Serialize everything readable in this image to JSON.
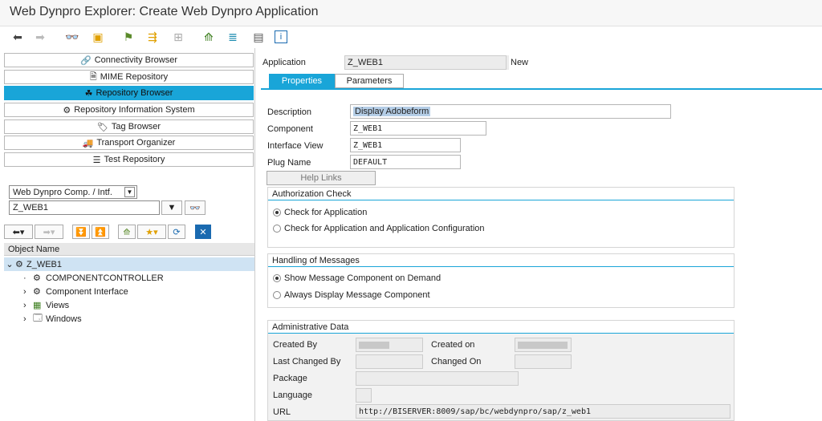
{
  "window": {
    "title": "Web Dynpro Explorer: Create Web Dynpro Application"
  },
  "nav": {
    "items": [
      {
        "label": "Connectivity Browser",
        "icon": "connectivity-icon"
      },
      {
        "label": "MIME Repository",
        "icon": "mime-icon"
      },
      {
        "label": "Repository Browser",
        "icon": "repository-icon",
        "active": true
      },
      {
        "label": "Repository Information System",
        "icon": "info-system-icon"
      },
      {
        "label": "Tag Browser",
        "icon": "tag-icon"
      },
      {
        "label": "Transport Organizer",
        "icon": "transport-icon"
      },
      {
        "label": "Test Repository",
        "icon": "test-icon"
      }
    ]
  },
  "object_selector": {
    "type_value": "Web Dynpro Comp. / Intf.",
    "name_value": "Z_WEB1"
  },
  "tree": {
    "header": "Object Name",
    "root": "Z_WEB1",
    "children": [
      "COMPONENTCONTROLLER",
      "Component Interface",
      "Views",
      "Windows"
    ]
  },
  "app": {
    "label": "Application",
    "value": "Z_WEB1",
    "status": "New"
  },
  "tabs": {
    "properties": "Properties",
    "parameters": "Parameters"
  },
  "props": {
    "description_label": "Description",
    "description_value": "Display Adobeform",
    "component_label": "Component",
    "component_value": "Z_WEB1",
    "interface_label": "Interface View",
    "interface_value": "Z_WEB1",
    "plug_label": "Plug Name",
    "plug_value": "DEFAULT",
    "help_links": "Help Links"
  },
  "auth": {
    "title": "Authorization Check",
    "opt1": "Check for Application",
    "opt2": "Check for Application and Application Configuration"
  },
  "messages": {
    "title": "Handling of Messages",
    "opt1": "Show Message Component on Demand",
    "opt2": "Always Display Message Component"
  },
  "admin": {
    "title": "Administrative Data",
    "created_by_label": "Created By",
    "created_on_label": "Created on",
    "last_changed_by_label": "Last Changed By",
    "changed_on_label": "Changed On",
    "package_label": "Package",
    "language_label": "Language",
    "url_label": "URL",
    "url_value": "http://BISERVER:8009/sap/bc/webdynpro/sap/z_web1"
  }
}
